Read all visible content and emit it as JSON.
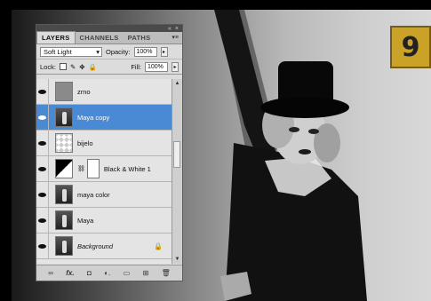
{
  "badge": {
    "text": "9",
    "color": "#c9a227"
  },
  "panel": {
    "tabs": [
      "LAYERS",
      "CHANNELS",
      "PATHS"
    ],
    "tab_menu_icon": "panel-menu-icon",
    "blend_mode": "Soft Light",
    "opacity_label": "Opacity:",
    "opacity_value": "100%",
    "lock_label": "Lock:",
    "fill_label": "Fill:",
    "fill_value": "100%",
    "layers": [
      {
        "name": "zrno",
        "thumb": "grey",
        "selected": false,
        "italic": false
      },
      {
        "name": "Maya copy",
        "thumb": "photo",
        "selected": true,
        "italic": false
      },
      {
        "name": "bijelo",
        "thumb": "checker",
        "selected": false,
        "italic": false
      },
      {
        "name": "Black & White 1",
        "thumb": "adjustment",
        "selected": false,
        "italic": false,
        "mask": true
      },
      {
        "name": "maya color",
        "thumb": "photo",
        "selected": false,
        "italic": false
      },
      {
        "name": "Maya",
        "thumb": "photo",
        "selected": false,
        "italic": false
      },
      {
        "name": "Background",
        "thumb": "photo",
        "selected": false,
        "italic": true,
        "locked": true
      }
    ],
    "bottom_icons": [
      "link-layers-icon",
      "fx-icon",
      "add-mask-icon",
      "adjustment-icon",
      "new-group-icon",
      "new-layer-icon",
      "trash-icon"
    ],
    "bottom_glyphs": [
      "∞",
      "fx.",
      "◘",
      "◐.",
      "▭",
      "⊞",
      "🗑"
    ],
    "selected_color": "#4a8ad4"
  }
}
